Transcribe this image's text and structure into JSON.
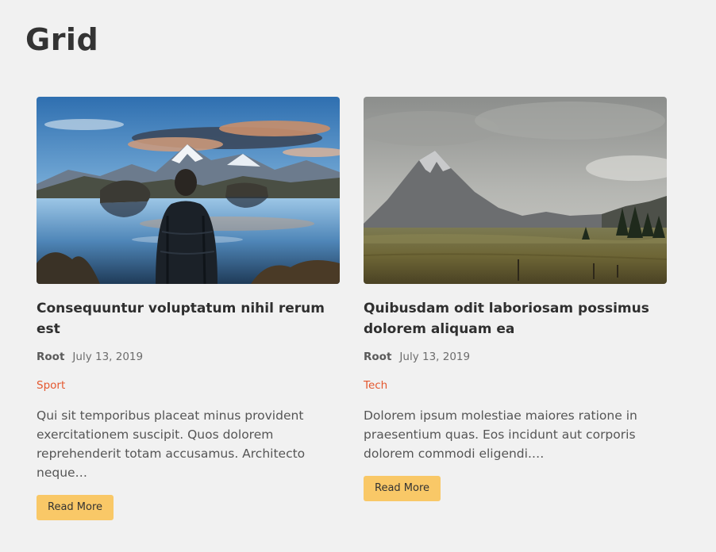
{
  "page": {
    "title": "Grid"
  },
  "posts": [
    {
      "image_alt": "Man standing by mountain lake",
      "title": "Consequuntur voluptatum nihil rerum est",
      "author": "Root",
      "date": "July 13, 2019",
      "category": "Sport",
      "excerpt": "Qui sit temporibus placeat minus provident exercitationem suscipit. Quos dolorem reprehenderit totam accusamus. Architecto neque…",
      "button_label": "Read More"
    },
    {
      "image_alt": "Mountain meadow under cloudy sky",
      "title": "Quibusdam odit laboriosam possimus dolorem aliquam ea",
      "author": "Root",
      "date": "July 13, 2019",
      "category": "Tech",
      "excerpt": "Dolorem ipsum molestiae maiores ratione in praesentium quas. Eos incidunt aut corporis dolorem commodi eligendi.…",
      "button_label": "Read More"
    }
  ],
  "colors": {
    "background": "#f1f1f1",
    "category": "#e4572e",
    "button": "#f9c867"
  }
}
